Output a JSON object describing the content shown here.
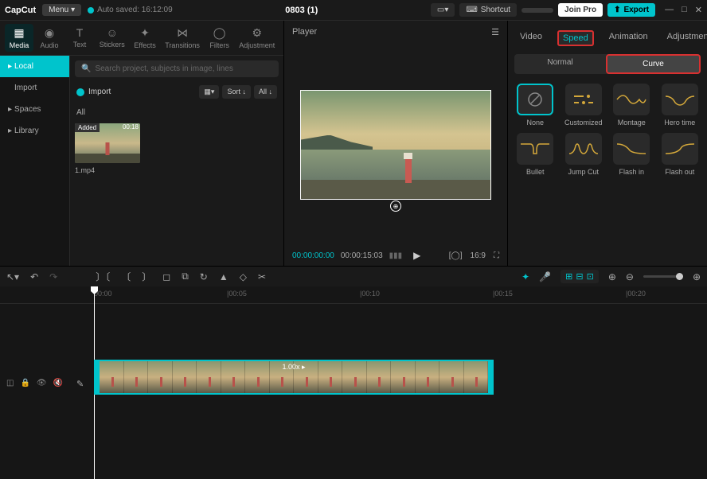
{
  "topbar": {
    "logo": "CapCut",
    "menu": "Menu",
    "autosave": "Auto saved: 16:12:09",
    "title": "0803 (1)",
    "shortcut": "Shortcut",
    "join_pro": "Join Pro",
    "export": "Export"
  },
  "mediaTabs": [
    {
      "label": "Media"
    },
    {
      "label": "Audio"
    },
    {
      "label": "Text"
    },
    {
      "label": "Stickers"
    },
    {
      "label": "Effects"
    },
    {
      "label": "Transitions"
    },
    {
      "label": "Filters"
    },
    {
      "label": "Adjustment"
    }
  ],
  "sidebar": {
    "local": "Local",
    "import": "Import",
    "spaces": "Spaces",
    "library": "Library"
  },
  "media": {
    "search_placeholder": "Search project, subjects in image, lines",
    "import": "Import",
    "sort": "Sort",
    "all": "All",
    "all_label": "All",
    "thumb": {
      "added": "Added",
      "duration": "00:18",
      "name": "1.mp4"
    }
  },
  "player": {
    "title": "Player",
    "time_current": "00:00:00:00",
    "time_duration": "00:00:15:03"
  },
  "rightTabs": {
    "video": "Video",
    "speed": "Speed",
    "animation": "Animation",
    "adjustment": "Adjustment"
  },
  "speedSeg": {
    "normal": "Normal",
    "curve": "Curve"
  },
  "curves": [
    {
      "name": "None"
    },
    {
      "name": "Customized"
    },
    {
      "name": "Montage"
    },
    {
      "name": "Hero time"
    },
    {
      "name": "Bullet"
    },
    {
      "name": "Jump Cut"
    },
    {
      "name": "Flash in"
    },
    {
      "name": "Flash out"
    }
  ],
  "ruler": [
    {
      "pos": 118,
      "t": "00:00"
    },
    {
      "pos": 285,
      "t": "|00:05"
    },
    {
      "pos": 452,
      "t": "|00:10"
    },
    {
      "pos": 619,
      "t": "|00:15"
    },
    {
      "pos": 786,
      "t": "|00:20"
    }
  ],
  "clip": {
    "speed": "1.00x ▸"
  }
}
